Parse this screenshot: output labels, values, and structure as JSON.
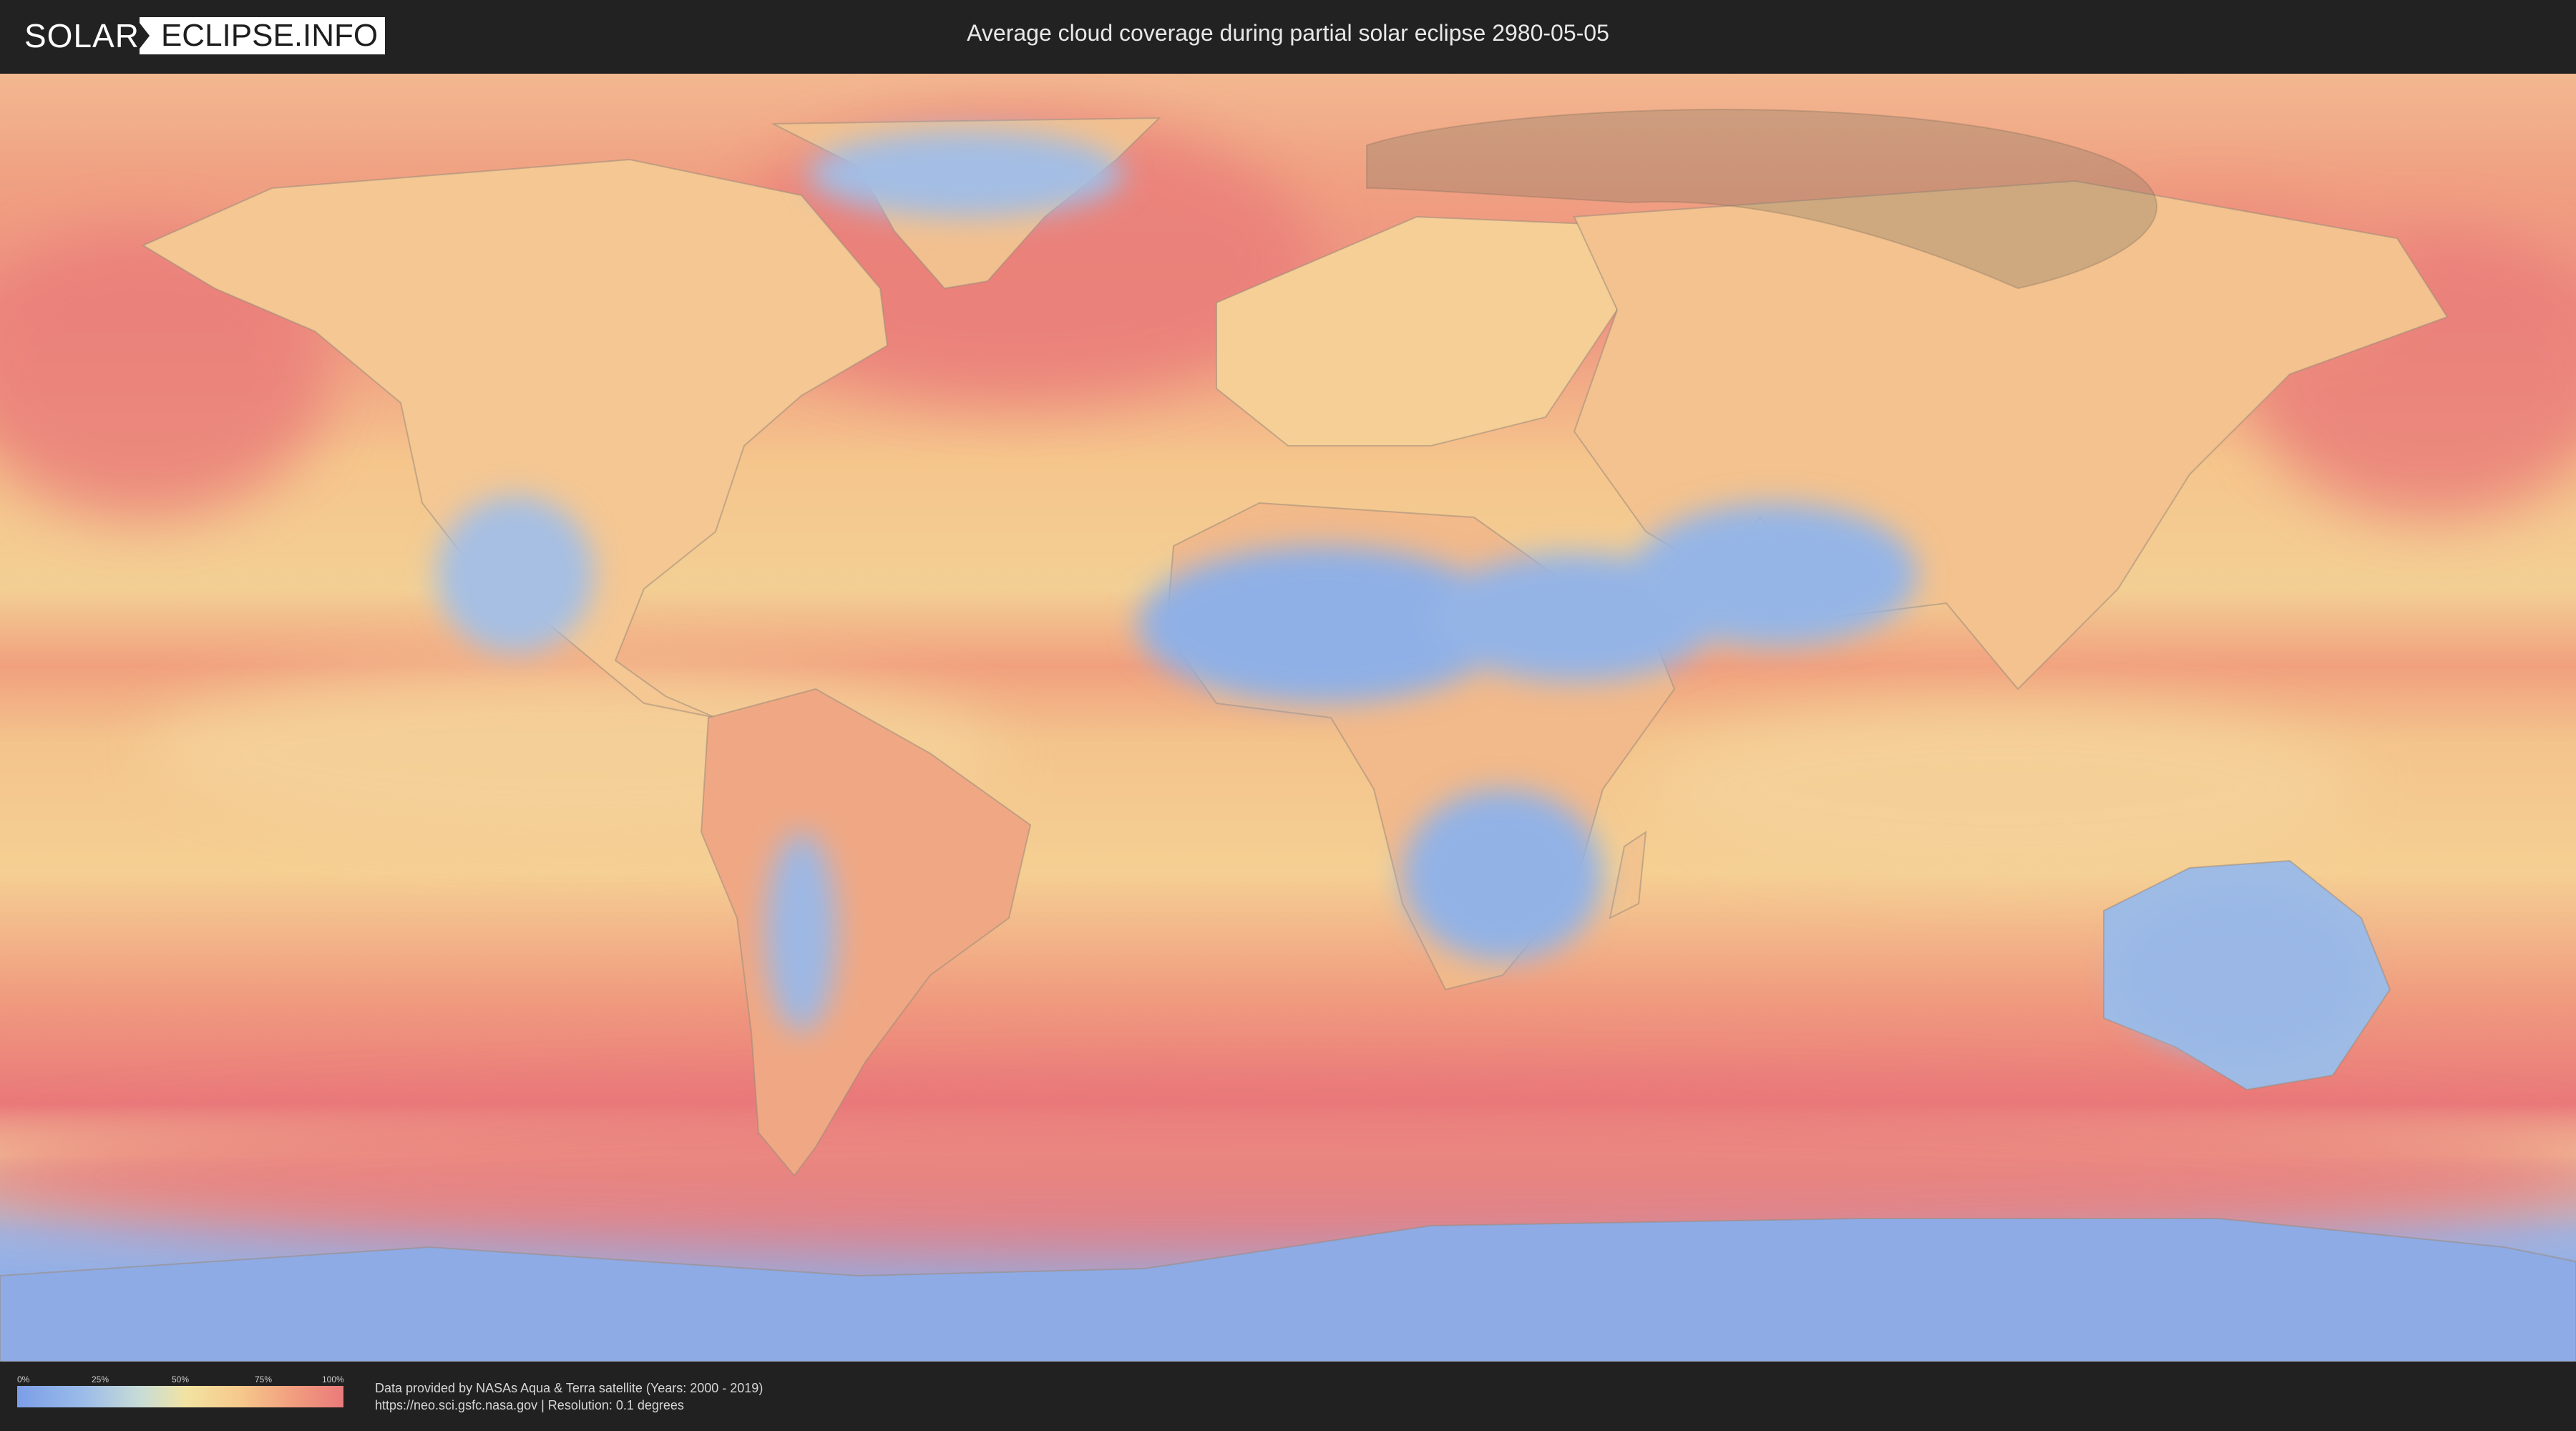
{
  "header": {
    "logo_left": "SOLAR",
    "logo_right": "ECLIPSE.INFO",
    "title": "Average cloud coverage during partial solar eclipse 2980-05-05"
  },
  "legend": {
    "ticks": [
      "0%",
      "25%",
      "50%",
      "75%",
      "100%"
    ],
    "colors": {
      "low": "#7b9ee8",
      "mid": "#f2e3a2",
      "high": "#ea7a7a"
    }
  },
  "credits": {
    "line1": "Data provided by NASAs Aqua & Terra satellite (Years: 2000 - 2019)",
    "line2": "https://neo.sci.gsfc.nasa.gov | Resolution: 0.1 degrees"
  },
  "map": {
    "eclipse_zone_color": "#8a7a66",
    "ocean_high_cloud": "#ea7a7a",
    "clear_region": "#8fb0e6"
  }
}
